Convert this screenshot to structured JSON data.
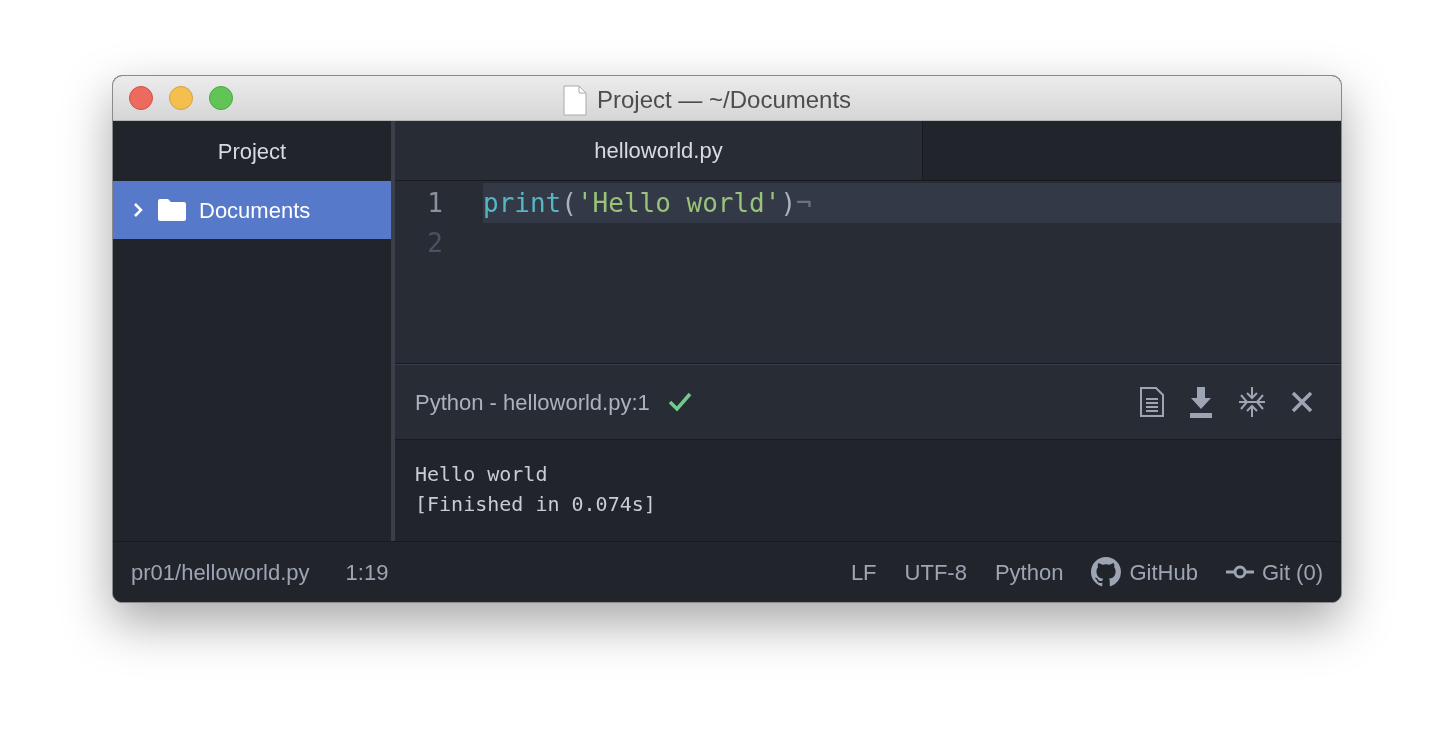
{
  "window": {
    "title": "Project — ~/Documents"
  },
  "sidebar": {
    "title": "Project",
    "items": [
      {
        "label": "Documents",
        "selected": true,
        "expanded": false
      }
    ]
  },
  "tabs": [
    {
      "label": "helloworld.py",
      "selected": true
    }
  ],
  "editor": {
    "lines": [
      {
        "number": "1",
        "current": true,
        "tokens": [
          {
            "kind": "function",
            "text": "print"
          },
          {
            "kind": "punct",
            "text": "("
          },
          {
            "kind": "string",
            "text": "'Hello world'"
          },
          {
            "kind": "punct",
            "text": ")"
          },
          {
            "kind": "invisible",
            "text": "¬"
          }
        ]
      },
      {
        "number": "2",
        "current": false
      }
    ]
  },
  "panel": {
    "title": "Python - helloworld.py:1",
    "success": true,
    "output": [
      "Hello world",
      "[Finished in 0.074s]"
    ]
  },
  "status_bar": {
    "left": [
      "pr01/helloworld.py",
      "1:19"
    ],
    "right": [
      {
        "kind": "plain",
        "text": "LF"
      },
      {
        "kind": "plain",
        "text": "UTF-8"
      },
      {
        "kind": "plain",
        "text": "Python"
      },
      {
        "kind": "github",
        "text": "GitHub"
      },
      {
        "kind": "git",
        "text": "Git (0)"
      }
    ]
  }
}
